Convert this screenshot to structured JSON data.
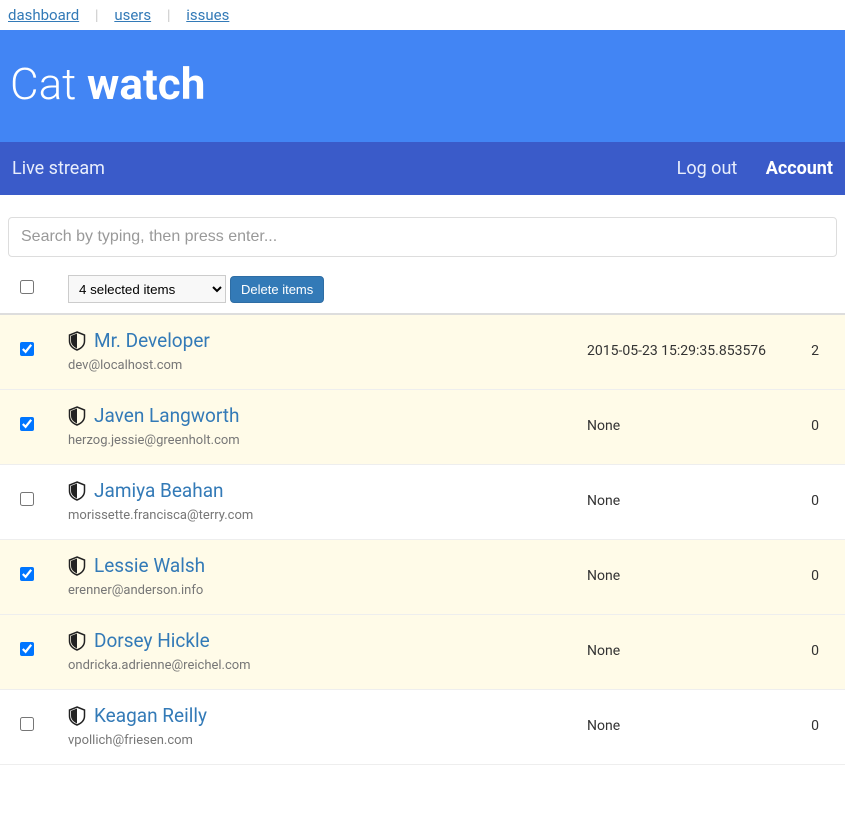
{
  "topnav": {
    "dashboard": "dashboard",
    "users": "users",
    "issues": "issues"
  },
  "header": {
    "title_light": "Cat ",
    "title_bold": "watch"
  },
  "subnav": {
    "left": "Live stream",
    "logout": "Log out",
    "account": "Account"
  },
  "search": {
    "placeholder": "Search by typing, then press enter..."
  },
  "toolbar": {
    "select_label": "4 selected items",
    "delete_label": "Delete items"
  },
  "rows": [
    {
      "selected": true,
      "name": "Mr. Developer",
      "email": "dev@localhost.com",
      "ts": "2015-05-23 15:29:35.853576",
      "count": "2"
    },
    {
      "selected": true,
      "name": "Javen Langworth",
      "email": "herzog.jessie@greenholt.com",
      "ts": "None",
      "count": "0"
    },
    {
      "selected": false,
      "name": "Jamiya Beahan",
      "email": "morissette.francisca@terry.com",
      "ts": "None",
      "count": "0"
    },
    {
      "selected": true,
      "name": "Lessie Walsh",
      "email": "erenner@anderson.info",
      "ts": "None",
      "count": "0"
    },
    {
      "selected": true,
      "name": "Dorsey Hickle",
      "email": "ondricka.adrienne@reichel.com",
      "ts": "None",
      "count": "0"
    },
    {
      "selected": false,
      "name": "Keagan Reilly",
      "email": "vpollich@friesen.com",
      "ts": "None",
      "count": "0"
    }
  ]
}
